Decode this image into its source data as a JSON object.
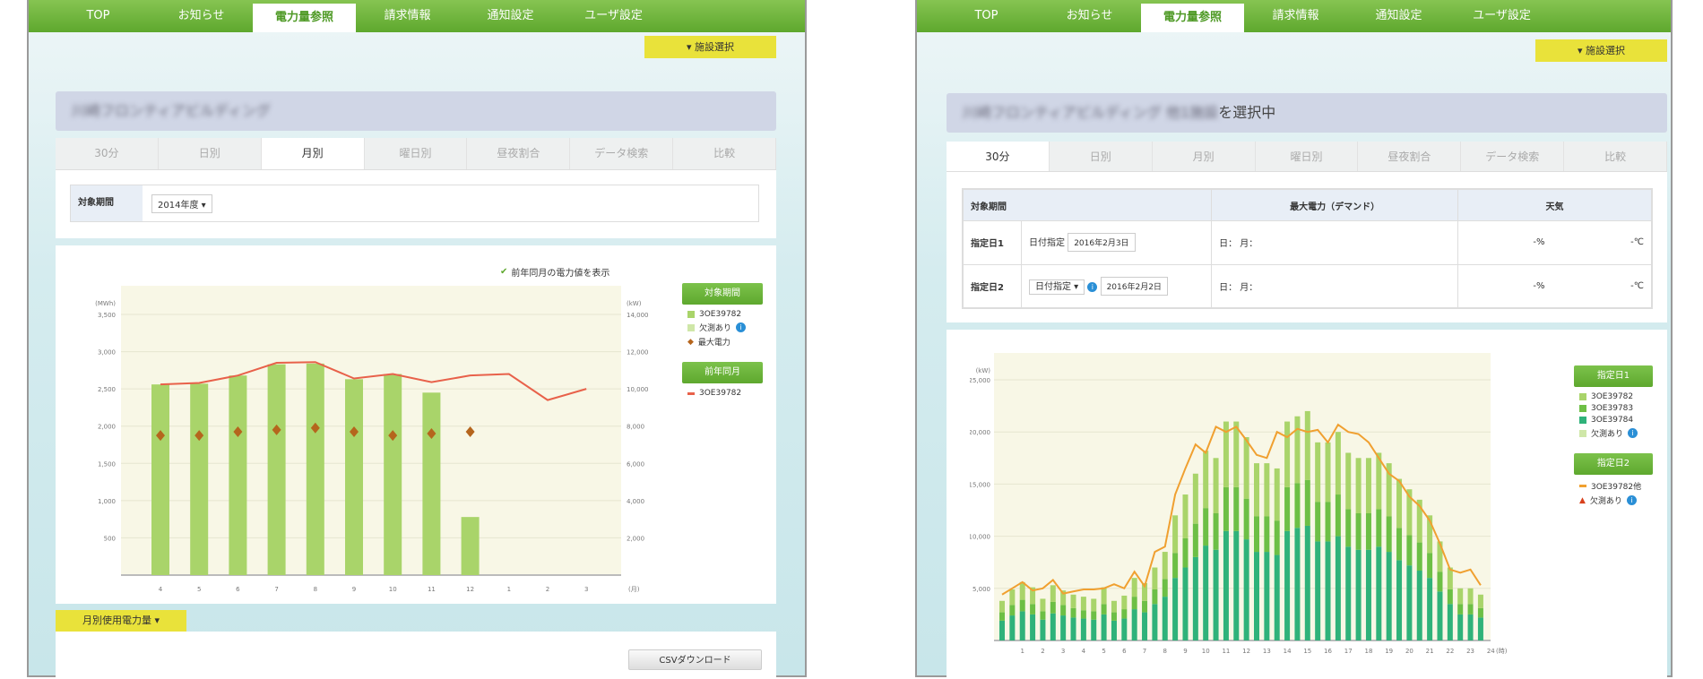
{
  "nav": [
    "TOP",
    "お知らせ",
    "電力量参照",
    "請求情報",
    "通知設定",
    "ユーザ設定"
  ],
  "nav_active": 2,
  "facility_button": "▾ 施設選択",
  "tabs": [
    "30分",
    "日別",
    "月別",
    "曜日別",
    "昼夜割合",
    "データ検索",
    "比較"
  ],
  "left": {
    "building": "川崎フロンティアビルディング",
    "active_tab": 2,
    "period_label": "対象期間",
    "period_value": "2014年度",
    "prev_year_checkbox": "前年同月の電力値を表示",
    "prev_year_checked": true,
    "legend": {
      "group1": "対象期間",
      "s1": "3OE39782",
      "missing": "欠測あり",
      "max": "最大電力",
      "group2": "前年同月",
      "prev": "3OE39782"
    },
    "section_label": "月別使用電力量 ▾",
    "csv_button": "CSVダウンロード"
  },
  "right": {
    "building": "川崎フロンティアビルディング 他1施設",
    "selected_suffix": "を選択中",
    "active_tab": 0,
    "table": {
      "headers": [
        "対象期間",
        "最大電力（デマンド）",
        "天気"
      ],
      "rows": [
        {
          "label": "指定日1",
          "mode": "日付指定",
          "date": "2016年2月3日",
          "demand": "日：  月：",
          "temp": "-%",
          "weather": "-℃"
        },
        {
          "label": "指定日2",
          "mode": "日付指定",
          "date": "2016年2月2日",
          "demand": "日：  月：",
          "temp": "-%",
          "weather": "-℃"
        }
      ]
    },
    "legend": {
      "group1": "指定日1",
      "s1": "3OE39782",
      "s2": "3OE39783",
      "s3": "3OE39784",
      "missing": "欠測あり",
      "group2": "指定日2",
      "line": "3OE39782他",
      "missing2": "欠測あり"
    }
  },
  "colors": {
    "nav_green": "#6db33f",
    "bar_light": "#a9d46a",
    "bar_mid": "#6dbf45",
    "bar_dark": "#2fb27a",
    "prev_line": "#e8614a",
    "max_marker": "#b5651d",
    "day2_line": "#f0a030",
    "yellow": "#e9e23a"
  },
  "chart_data": [
    {
      "type": "bar",
      "ylabel": "(MWh)",
      "y2label": "(kW)",
      "xunit": "(月)",
      "categories": [
        "4",
        "5",
        "6",
        "7",
        "8",
        "9",
        "10",
        "11",
        "12",
        "1",
        "2",
        "3"
      ],
      "ylim": [
        0,
        3500
      ],
      "yticks": [
        "500",
        "1,000",
        "1,500",
        "2,000",
        "2,500",
        "3,000",
        "3,500"
      ],
      "y2lim": [
        0,
        14000
      ],
      "y2ticks": [
        "2,000",
        "4,000",
        "6,000",
        "8,000",
        "10,000",
        "12,000",
        "14,000"
      ],
      "series": [
        {
          "name": "3OE39782",
          "type": "bar",
          "values": [
            2560,
            2570,
            2680,
            2830,
            2840,
            2630,
            2700,
            2450,
            780,
            null,
            null,
            null
          ]
        },
        {
          "name": "最大電力",
          "type": "scatter",
          "axis": "y2",
          "values": [
            7500,
            7500,
            7700,
            7800,
            7900,
            7700,
            7500,
            7600,
            7700,
            null,
            null,
            null
          ]
        },
        {
          "name": "3OE39782",
          "type": "line",
          "values": [
            2560,
            2580,
            2680,
            2850,
            2860,
            2640,
            2700,
            2590,
            2680,
            2700,
            2350,
            2500
          ]
        }
      ],
      "grid": true,
      "legend": "right"
    },
    {
      "type": "bar",
      "stacked": true,
      "ylabel": "(kW)",
      "xunit": "(時)",
      "xticks": [
        "1",
        "2",
        "3",
        "4",
        "5",
        "6",
        "7",
        "8",
        "9",
        "10",
        "11",
        "12",
        "13",
        "14",
        "15",
        "16",
        "17",
        "18",
        "19",
        "20",
        "21",
        "22",
        "23",
        "24"
      ],
      "ylim": [
        0,
        25000
      ],
      "yticks": [
        "5,000",
        "10,000",
        "15,000",
        "20,000",
        "25,000"
      ],
      "series": [
        {
          "name": "3OE39784",
          "values": [
            1900,
            2400,
            2800,
            2500,
            2000,
            2600,
            2400,
            2200,
            2100,
            2000,
            2500,
            1900,
            2100,
            3000,
            2700,
            3500,
            4200,
            6000,
            7000,
            8000,
            9100,
            8700,
            10500,
            10500,
            9700,
            8500,
            8500,
            8200,
            10500,
            10800,
            11000,
            9500,
            9500,
            10000,
            9000,
            8700,
            8700,
            9000,
            8500,
            7700,
            7200,
            6700,
            6000,
            4700,
            3500,
            2500,
            2500,
            2200
          ]
        },
        {
          "name": "3OE39783",
          "values": [
            800,
            1000,
            1100,
            1000,
            800,
            1100,
            1000,
            900,
            800,
            800,
            1000,
            800,
            900,
            1200,
            1100,
            1400,
            1700,
            2400,
            2800,
            3200,
            3600,
            3500,
            4200,
            4200,
            3900,
            3400,
            3400,
            3300,
            4200,
            4300,
            4400,
            3800,
            3800,
            4000,
            3600,
            3500,
            3500,
            3600,
            3400,
            3100,
            2900,
            2700,
            2400,
            1900,
            1400,
            1000,
            1000,
            900
          ]
        },
        {
          "name": "3OE39782",
          "values": [
            1100,
            1500,
            1700,
            1600,
            1200,
            1600,
            1400,
            1300,
            1300,
            1200,
            1600,
            1100,
            1300,
            1800,
            1700,
            2100,
            2600,
            3600,
            4200,
            4800,
            5500,
            5300,
            6300,
            6300,
            5900,
            5100,
            5100,
            5000,
            6300,
            6400,
            6600,
            5700,
            5700,
            6000,
            5400,
            5300,
            5300,
            5400,
            5100,
            4700,
            4400,
            4100,
            3600,
            2900,
            2100,
            1500,
            1500,
            1300
          ]
        },
        {
          "name": "3OE39782他",
          "type": "line",
          "values": [
            4400,
            5000,
            5600,
            4800,
            5000,
            5800,
            4500,
            4700,
            4900,
            4900,
            5000,
            5400,
            5000,
            6600,
            5200,
            8500,
            9000,
            14000,
            16500,
            18800,
            18000,
            20500,
            20000,
            20500,
            19200,
            17800,
            17500,
            20000,
            19500,
            20300,
            20000,
            20200,
            19000,
            20700,
            20000,
            19800,
            19000,
            17500,
            16000,
            15300,
            13800,
            12900,
            11500,
            9300,
            6800,
            6500,
            6800,
            5300
          ]
        }
      ],
      "grid": true,
      "legend": "right"
    }
  ]
}
